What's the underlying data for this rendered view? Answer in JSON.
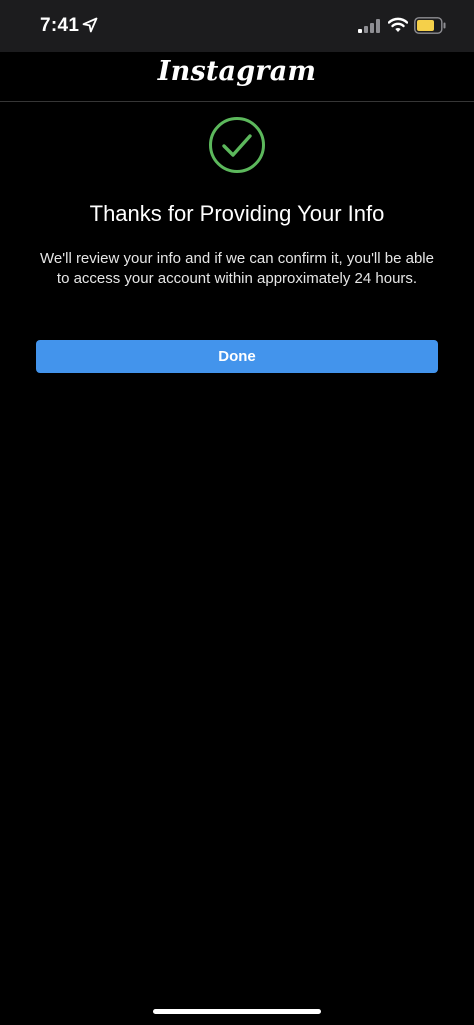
{
  "status_bar": {
    "time": "7:41",
    "icons": [
      "location-arrow-icon",
      "cellular-signal-icon",
      "wifi-icon",
      "battery-icon"
    ],
    "battery_color": "#f5d04a"
  },
  "header": {
    "logo_text": "Instagram"
  },
  "confirmation": {
    "icon": "checkmark-circle-icon",
    "icon_color": "#5cb85c",
    "title": "Thanks for Providing Your Info",
    "message": "We'll review your info and if we can confirm it, you'll be able to access your account within approximately 24 hours."
  },
  "actions": {
    "done_label": "Done",
    "done_color": "#4394ec"
  }
}
